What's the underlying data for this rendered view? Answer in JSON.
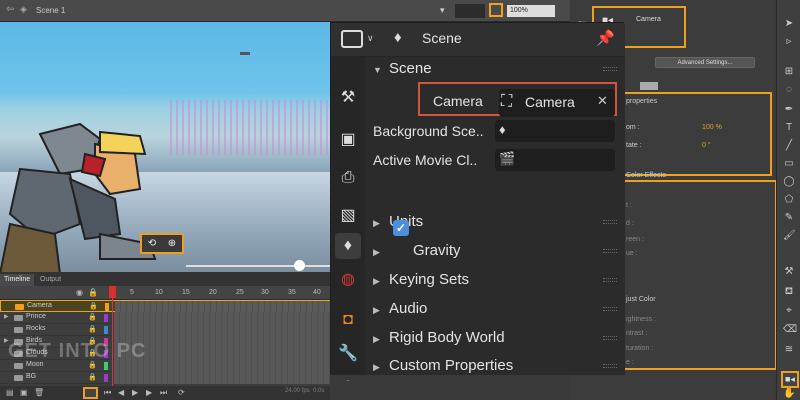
{
  "top_bar": {
    "scene_label": "Scene 1",
    "zoom": "100%"
  },
  "stage": {
    "slider_value": 0.75
  },
  "timeline": {
    "tabs": [
      "Timeline",
      "Output"
    ],
    "frame_numbers": [
      "1",
      "5",
      "10",
      "15",
      "20",
      "25",
      "30",
      "35",
      "40"
    ],
    "layers": [
      {
        "name": "Camera",
        "color": "#f0a020"
      },
      {
        "name": "Prince",
        "color": "#9b3bd0"
      },
      {
        "name": "Rocks",
        "color": "#3b8ad0"
      },
      {
        "name": "Birds",
        "color": "#d03b9b"
      },
      {
        "name": "Clouds",
        "color": "#9b3bd0"
      },
      {
        "name": "Moon",
        "color": "#3bd06a"
      },
      {
        "name": "BG",
        "color": "#9b3bd0"
      }
    ],
    "fps": "24.00 fps",
    "time": "0.0s"
  },
  "watermark": "GET INTO PC",
  "props_right": {
    "camera_tab": "Camera",
    "advanced_settings": "Advanced Settings...",
    "section_properties": "properties",
    "zoom_label": "om :",
    "zoom_value": "100 %",
    "rotate_label": "tate :",
    "rotate_value": "0 °",
    "section_color_effects": "Color Effects",
    "tint_label": "t :",
    "red_label": "d :",
    "green_label": "reen :",
    "blue_label": "ue :",
    "adjust_color": "just Color",
    "brightness_label": "ightness :",
    "contrast_label": "ntrast :",
    "saturation_label": "turation :",
    "hue_label": "e :"
  },
  "blender": {
    "header_title": "Scene",
    "panel_title": "Scene",
    "camera_label": "Camera",
    "camera_value": "Camera",
    "background_label": "Background Sce..",
    "active_clip_label": "Active Movie Cl..",
    "sections": [
      "Units",
      "Gravity",
      "Keying Sets",
      "Audio",
      "Rigid Body World",
      "Custom Properties"
    ]
  },
  "colors": {
    "highlight": "#f0a020",
    "blender_highlight": "#d4533b",
    "checkbox": "#4d8fdb"
  }
}
